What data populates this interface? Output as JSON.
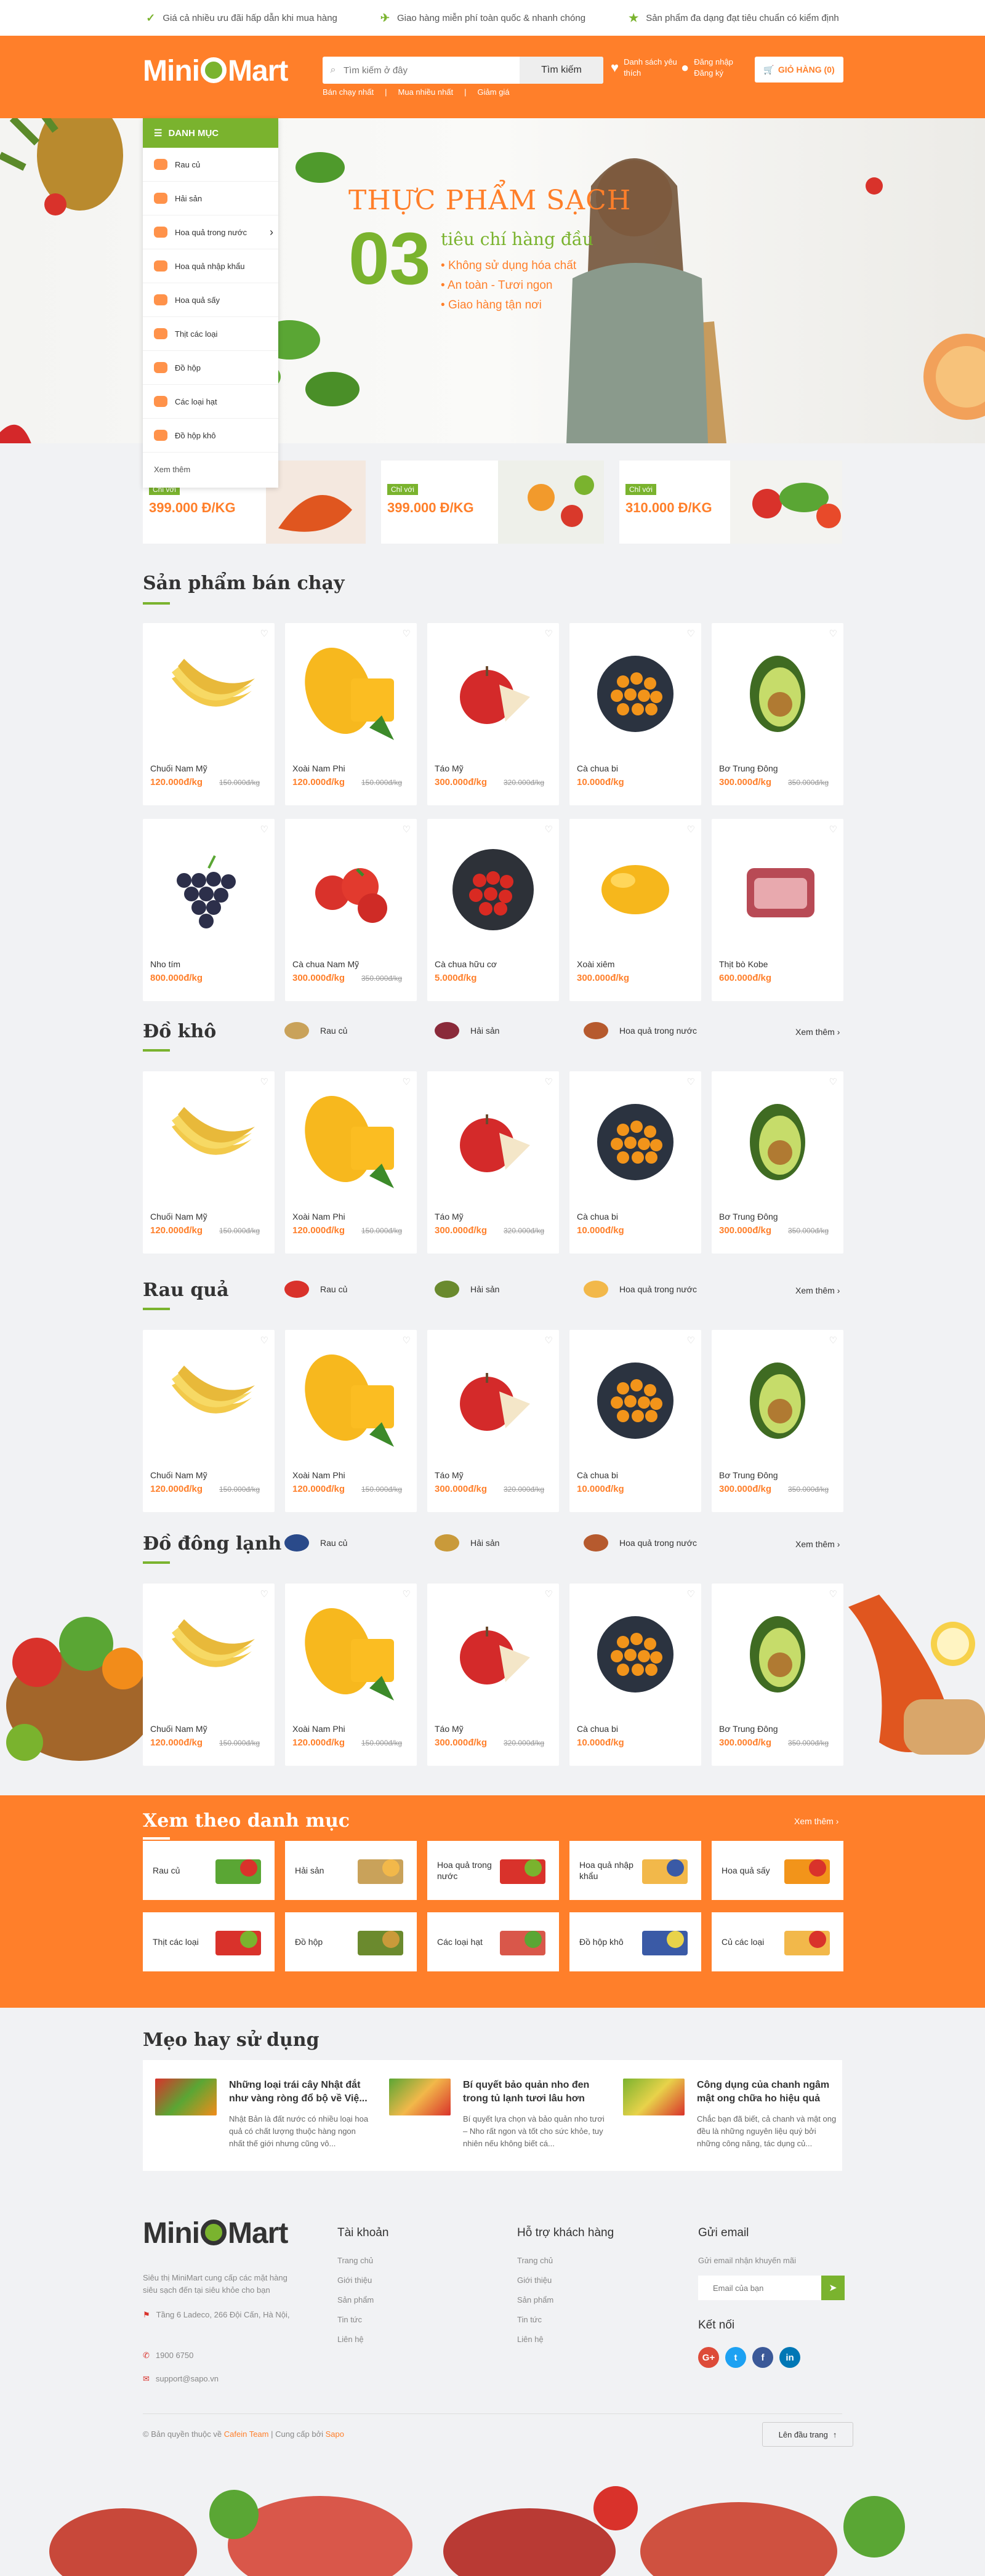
{
  "topbar": [
    {
      "text": "Giá cả nhiều ưu đãi hấp dẫn khi mua hàng"
    },
    {
      "text": "Giao hàng miễn phí toàn quốc & nhanh chóng"
    },
    {
      "text": "Sản phẩm đa dạng đạt tiêu chuẩn có kiểm định"
    }
  ],
  "header": {
    "logo_left": "Mini",
    "logo_right": "Mart",
    "search_placeholder": "Tìm kiếm ở đây",
    "search_button": "Tìm kiếm",
    "quick_links": [
      "Bán chạy nhất",
      "Mua nhiều nhất",
      "Giảm giá"
    ],
    "wishlist": "Danh sách yêu thích",
    "login": "Đăng nhập",
    "register": "Đăng ký",
    "cart": "GIỎ HÀNG (0)"
  },
  "category_menu": {
    "title": "DANH MỤC",
    "items": [
      "Rau củ",
      "Hải sản",
      "Hoa quả trong nước",
      "Hoa quả nhập khẩu",
      "Hoa quả sấy",
      "Thịt các loại",
      "Đồ hộp",
      "Các loại hạt",
      "Đồ hộp khô"
    ],
    "more": "Xem thêm"
  },
  "hero": {
    "title": "THỰC PHẨM SẠCH",
    "number": "03",
    "subtitle": "tiêu chí hàng đầu",
    "points": [
      "Không sử dụng hóa chất",
      "An toàn - Tươi ngon",
      "Giao hàng tận nơi"
    ]
  },
  "banners": [
    {
      "tag": "Chỉ với",
      "price": "399.000 Đ/KG"
    },
    {
      "tag": "Chỉ với",
      "price": "399.000 Đ/KG"
    },
    {
      "tag": "Chỉ với",
      "price": "310.000 Đ/KG"
    }
  ],
  "bestseller": {
    "title": "Sản phẩm bán chạy",
    "products": [
      {
        "name": "Chuối Nam Mỹ",
        "price": "120.000đ/kg",
        "old": "150.000đ/kg",
        "img": "banana"
      },
      {
        "name": "Xoài Nam Phi",
        "price": "120.000đ/kg",
        "old": "150.000đ/kg",
        "img": "mango"
      },
      {
        "name": "Táo Mỹ",
        "price": "300.000đ/kg",
        "old": "320.000đ/kg",
        "img": "apple"
      },
      {
        "name": "Cà chua bi",
        "price": "10.000đ/kg",
        "old": "",
        "img": "cherry"
      },
      {
        "name": "Bơ Trung Đông",
        "price": "300.000đ/kg",
        "old": "350.000đ/kg",
        "img": "avocado"
      },
      {
        "name": "Nho tím",
        "price": "800.000đ/kg",
        "old": "",
        "img": "grape"
      },
      {
        "name": "Cà chua Nam Mỹ",
        "price": "300.000đ/kg",
        "old": "350.000đ/kg",
        "img": "tomato"
      },
      {
        "name": "Cà chua hữu cơ",
        "price": "5.000đ/kg",
        "old": "",
        "img": "tomatoplate"
      },
      {
        "name": "Xoài xiêm",
        "price": "300.000đ/kg",
        "old": "",
        "img": "mango2"
      },
      {
        "name": "Thịt bò Kobe",
        "price": "600.000đ/kg",
        "old": "",
        "img": "meat"
      }
    ]
  },
  "common_products": [
    {
      "name": "Chuối Nam Mỹ",
      "price": "120.000đ/kg",
      "old": "150.000đ/kg",
      "img": "banana"
    },
    {
      "name": "Xoài Nam Phi",
      "price": "120.000đ/kg",
      "old": "150.000đ/kg",
      "img": "mango"
    },
    {
      "name": "Táo Mỹ",
      "price": "300.000đ/kg",
      "old": "320.000đ/kg",
      "img": "apple"
    },
    {
      "name": "Cà chua bi",
      "price": "10.000đ/kg",
      "old": "",
      "img": "cherry"
    },
    {
      "name": "Bơ Trung Đông",
      "price": "300.000đ/kg",
      "old": "350.000đ/kg",
      "img": "avocado"
    }
  ],
  "sections": [
    {
      "title": "Đồ khô",
      "tabs": [
        "Rau củ",
        "Hải sản",
        "Hoa quả trong nước"
      ],
      "more": "Xem thêm"
    },
    {
      "title": "Rau quả",
      "tabs": [
        "Rau củ",
        "Hải sản",
        "Hoa quả trong nước"
      ],
      "more": "Xem thêm"
    },
    {
      "title": "Đồ đông lạnh",
      "tabs": [
        "Rau củ",
        "Hải sản",
        "Hoa quả trong nước"
      ],
      "more": "Xem thêm"
    }
  ],
  "rauqua_prices": [
    "120.000đ/kg",
    "120.000đ/kg",
    "300.000đ/kg",
    "10.000đ/kg",
    "300.000đ/kg"
  ],
  "by_category": {
    "title": "Xem theo danh mục",
    "more": "Xem thêm",
    "items": [
      "Rau củ",
      "Hải sản",
      "Hoa quả trong nước",
      "Hoa quả nhập khẩu",
      "Hoa quả sấy",
      "Thịt các loại",
      "Đồ hộp",
      "Các loại hạt",
      "Đồ hộp khô",
      "Củ các loại"
    ]
  },
  "tips": {
    "title": "Mẹo hay sử dụng",
    "posts": [
      {
        "title": "Những loại trái cây Nhật đắt như vàng ròng đổ bộ về Việ...",
        "desc": "Nhật Bản là đất nước có nhiều loại hoa quả có chất lượng thuộc hàng ngon nhất thế giới nhưng cũng vô..."
      },
      {
        "title": "Bí quyết bảo quản nho đen trong tủ lạnh tươi lâu hơn",
        "desc": "Bí quyết lựa chọn và bảo quản nho tươi – Nho rất ngon và tốt cho sức khỏe, tuy nhiên nếu không biết cá..."
      },
      {
        "title": "Công dụng của chanh ngâm mật ong chữa ho hiệu quả",
        "desc": "Chắc bạn đã biết, cả chanh và mật ong đều là những nguyên liệu quý bởi những công năng, tác dụng củ..."
      }
    ]
  },
  "footer": {
    "desc": "Siêu thị MiniMart cung cấp các mặt hàng siêu sạch đến tại siêu khỏe cho bạn",
    "address": "Tầng 6 Ladeco, 266 Đội Cấn, Hà Nội,",
    "phone": "1900 6750",
    "email": "support@sapo.vn",
    "account_title": "Tài khoản",
    "account_links": [
      "Trang chủ",
      "Giới thiệu",
      "Sản phẩm",
      "Tin tức",
      "Liên hệ"
    ],
    "support_title": "Hỗ trợ khách hàng",
    "support_links": [
      "Trang chủ",
      "Giới thiệu",
      "Sản phẩm",
      "Tin tức",
      "Liên hệ"
    ],
    "newsletter_title": "Gửi email",
    "newsletter_desc": "Gửi email nhận khuyến mãi",
    "newsletter_placeholder": "Email của bạn",
    "social_title": "Kết nối",
    "social": [
      "G+",
      "t",
      "f",
      "in"
    ],
    "copyright_pre": "© Bản quyền thuộc về",
    "copyright_team": "Cafein Team",
    "copyright_sep": "| Cung cấp bởi",
    "copyright_sapo": "Sapo",
    "back_to_top": "Lên đầu trang"
  },
  "colors": {
    "orange": "#ff7f2a",
    "green": "#7ab32e"
  }
}
